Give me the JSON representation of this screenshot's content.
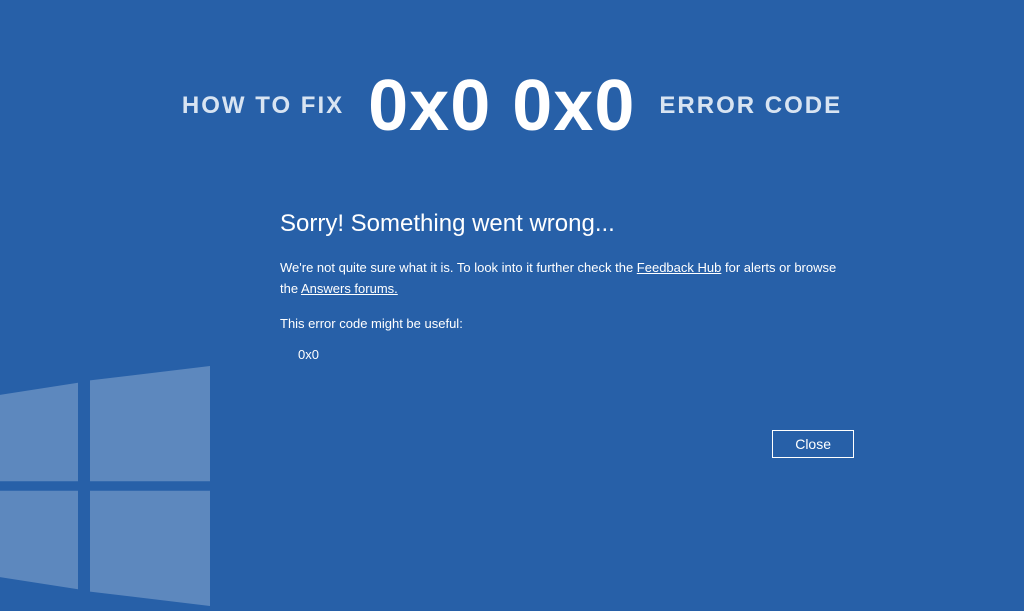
{
  "header": {
    "prefix": "HOW TO FIX",
    "code": "0x0 0x0",
    "suffix": "ERROR CODE"
  },
  "error": {
    "title": "Sorry! Something went wrong...",
    "desc_part1": "We're not quite sure what it is. To look into it further check the ",
    "link1": "Feedback Hub",
    "desc_part2": " for alerts or browse the ",
    "link2": "Answers forums.",
    "hint": "This error code might be useful:",
    "code": "0x0"
  },
  "buttons": {
    "close": "Close"
  }
}
